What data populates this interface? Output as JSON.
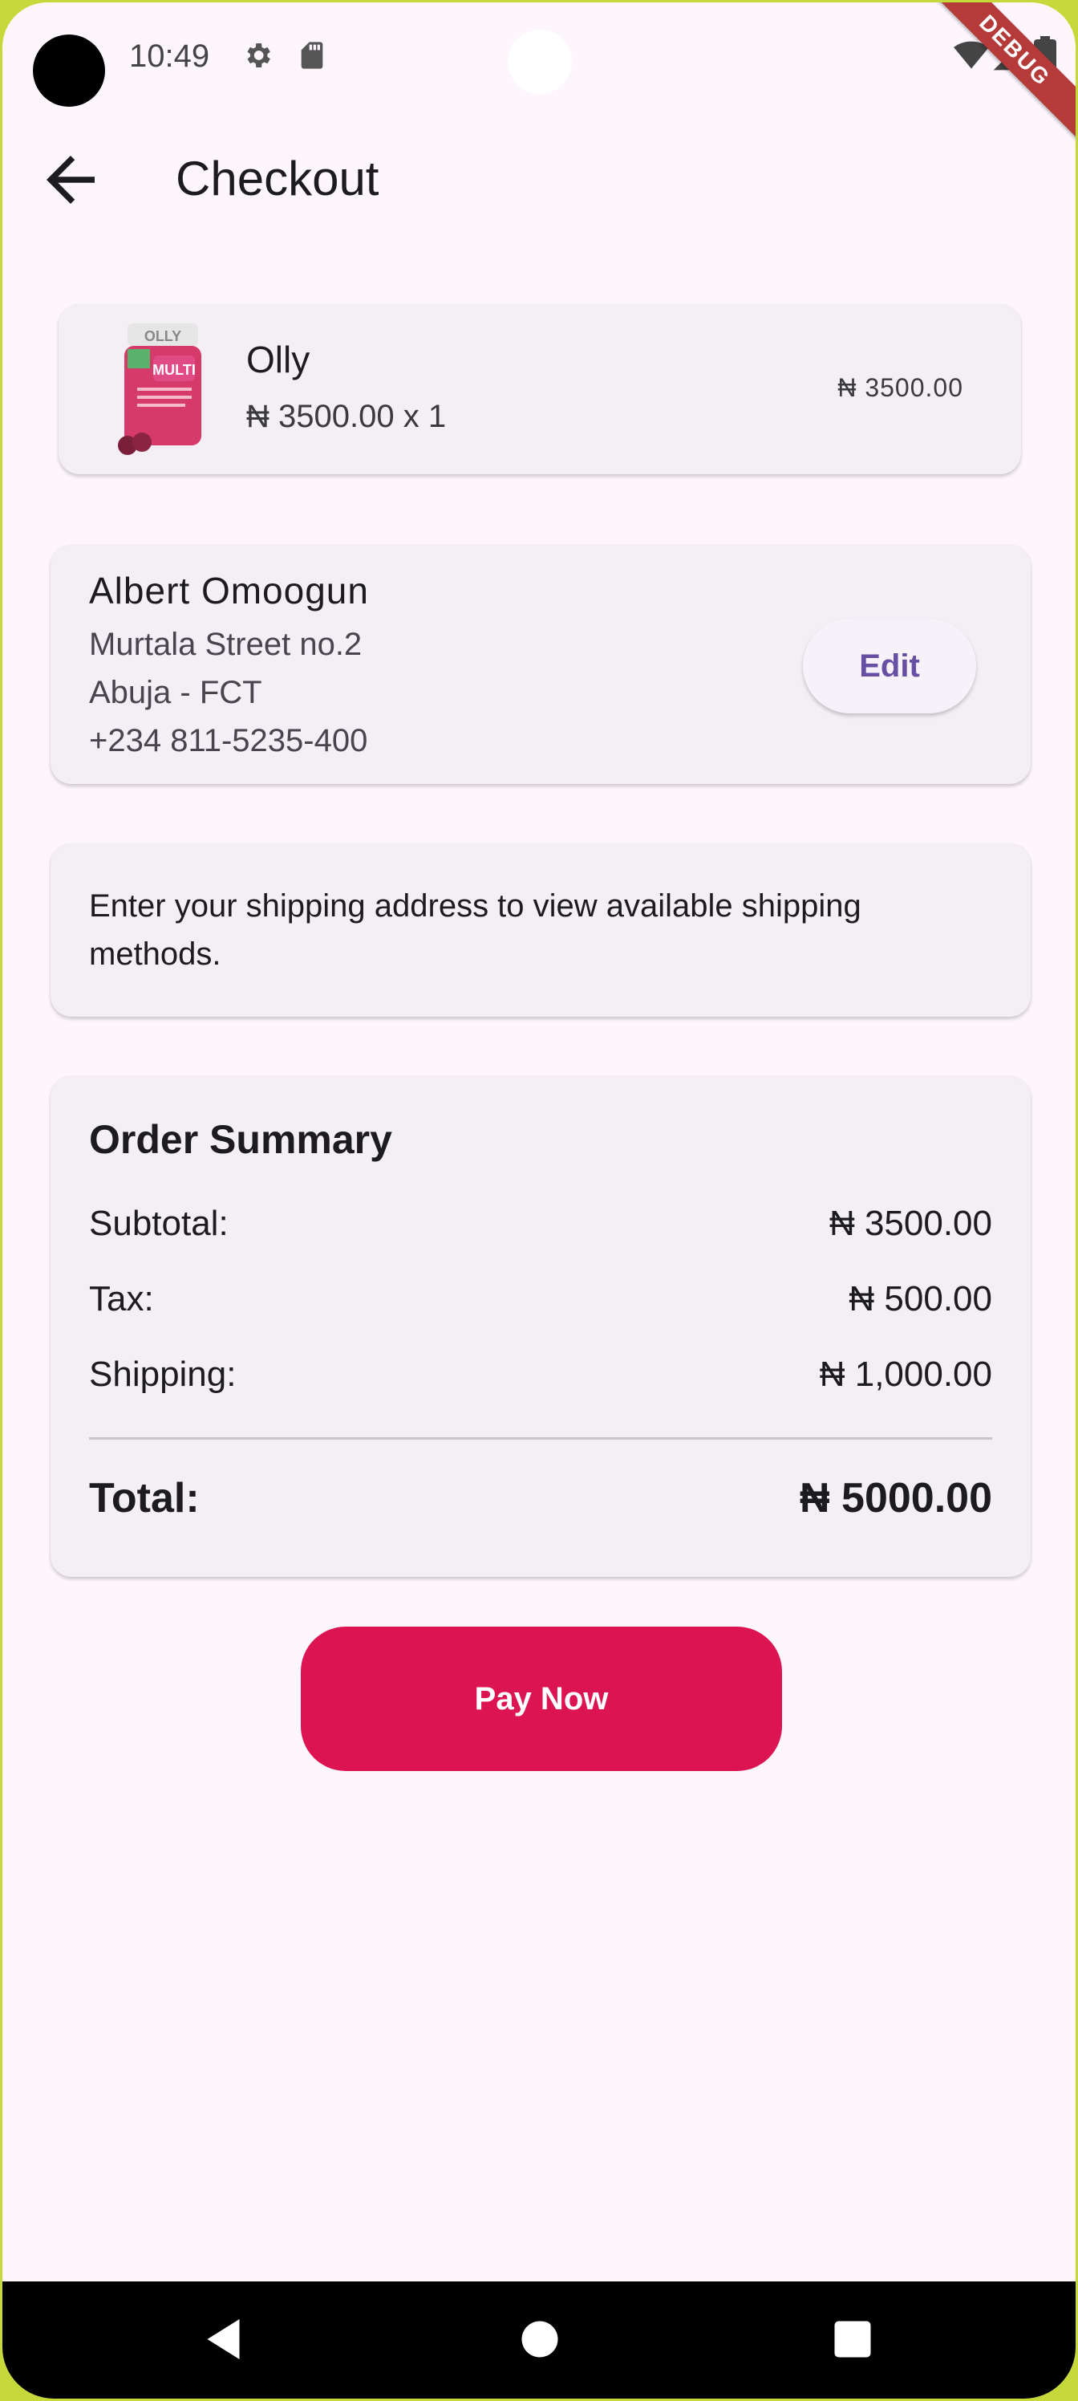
{
  "status_bar": {
    "time": "10:49",
    "debug_label": "DEBUG"
  },
  "app_bar": {
    "title": "Checkout",
    "back_icon": "arrow-back-icon"
  },
  "cart_item": {
    "name": "Olly",
    "unit_price_qty": "₦ 3500.00 x 1",
    "line_total": "₦ 3500.00"
  },
  "address": {
    "name": "Albert Omoogun",
    "street": "Murtala Street no.2",
    "city": "Abuja - FCT",
    "phone": "+234 811-5235-400",
    "edit_label": "Edit"
  },
  "shipping": {
    "message": "Enter your shipping address to view available shipping methods."
  },
  "order_summary": {
    "title": "Order Summary",
    "subtotal_label": "Subtotal:",
    "subtotal_value": "₦ 3500.00",
    "tax_label": "Tax:",
    "tax_value": "₦ 500.00",
    "shipping_label": "Shipping:",
    "shipping_value": "₦ 1,000.00",
    "total_label": "Total:",
    "total_value": "₦ 5000.00"
  },
  "pay_button": {
    "label": "Pay Now"
  },
  "colors": {
    "background": "#fdf7fd",
    "card": "#f4eff4",
    "accent": "#6750a4",
    "pay_button": "#dc1452",
    "debug_banner": "#b53a3a"
  }
}
